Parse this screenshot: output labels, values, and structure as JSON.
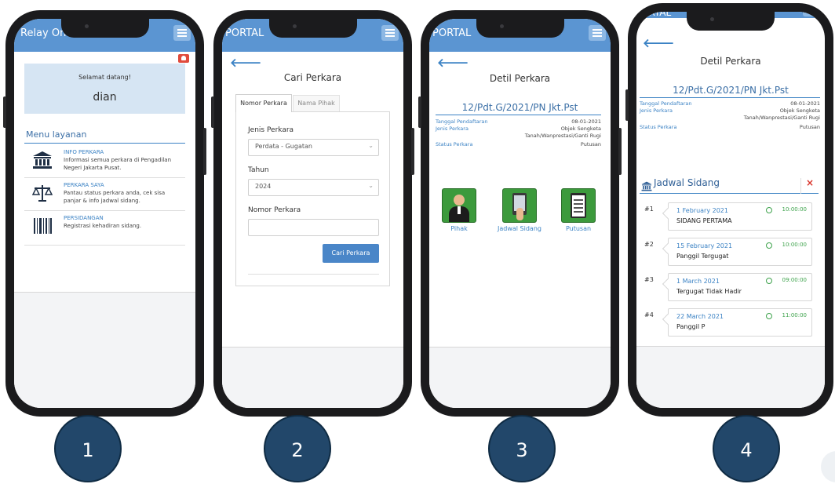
{
  "phone1": {
    "app_title": "Relay On P",
    "welcome": "Selamat datang!",
    "username": "dian",
    "menu_heading": "Menu layanan",
    "menu_items": [
      {
        "title": "INFO PERKARA",
        "line1": "Informasi semua perkara di Pengadilan",
        "line2": "Negeri Jakarta Pusat.",
        "icon": "courthouse-icon"
      },
      {
        "title": "PERKARA SAYA",
        "line1": "Pantau status perkara anda, cek sisa",
        "line2": "panjar & info jadwal sidang.",
        "icon": "scales-icon"
      },
      {
        "title": "PERSIDANGAN",
        "line1": "Registrasi kehadiran sidang.",
        "line2": "",
        "icon": "barcode-icon"
      }
    ],
    "colors": {
      "header": "#5b95d2",
      "welcome_bg": "#d6e5f3",
      "notification": "#e04b3c"
    }
  },
  "phone2": {
    "app_title": "PORTAL",
    "page_title": "Cari Perkara",
    "tabs": [
      "Nomor Perkara",
      "Nama Pihak"
    ],
    "active_tab": "Nomor Perkara",
    "jenis_label": "Jenis Perkara",
    "jenis_value": "Perdata - Gugatan",
    "tahun_label": "Tahun",
    "tahun_value": "2024",
    "nomor_label": "Nomor Perkara",
    "nomor_value": "",
    "search_button": "Cari Perkara"
  },
  "phone3": {
    "app_title": "PORTAL",
    "page_title": "Detil Perkara",
    "case_number": "12/Pdt.G/2021/PN Jkt.Pst",
    "details": [
      {
        "label": "Tanggal Pendaftaran",
        "value": "08-01-2021"
      },
      {
        "label": "Jenis Perkara",
        "value": "Objek Sengketa"
      },
      {
        "label": "",
        "value": "Tanah/Wanprestasi/Ganti Rugi"
      },
      {
        "label": "Status Perkara",
        "value": "Putusan"
      }
    ],
    "actions": [
      "Pihak",
      "Jadwal Sidang",
      "Putusan"
    ]
  },
  "phone4": {
    "header_fragment": "ORTAL",
    "page_title": "Detil Perkara",
    "case_number": "12/Pdt.G/2021/PN Jkt.Pst",
    "details": [
      {
        "label": "Tanggal Pendaftaran",
        "value": "08-01-2021"
      },
      {
        "label": "Jenis Perkara",
        "value": "Objek Sengketa"
      },
      {
        "label": "",
        "value": "Tanah/Wanprestasi/Ganti Rugi"
      },
      {
        "label": "Status Perkara",
        "value": "Putusan"
      }
    ],
    "schedule_title": "Jadwal Sidang",
    "close_symbol": "×",
    "schedule": [
      {
        "index": "#1",
        "date": "1 February 2021",
        "time": "10:00:00",
        "event": "SIDANG PERTAMA"
      },
      {
        "index": "#2",
        "date": "15 February 2021",
        "time": "10:00:00",
        "event": "Panggil Tergugat"
      },
      {
        "index": "#3",
        "date": "1 March 2021",
        "time": "09:00:00",
        "event": "Tergugat Tidak Hadir"
      },
      {
        "index": "#4",
        "date": "22 March 2021",
        "time": "11:00:00",
        "event": "Panggil P"
      }
    ],
    "colors": {
      "time": "#3fa34d",
      "close": "#d9342b"
    }
  },
  "step_numbers": [
    "1",
    "2",
    "3",
    "4"
  ]
}
